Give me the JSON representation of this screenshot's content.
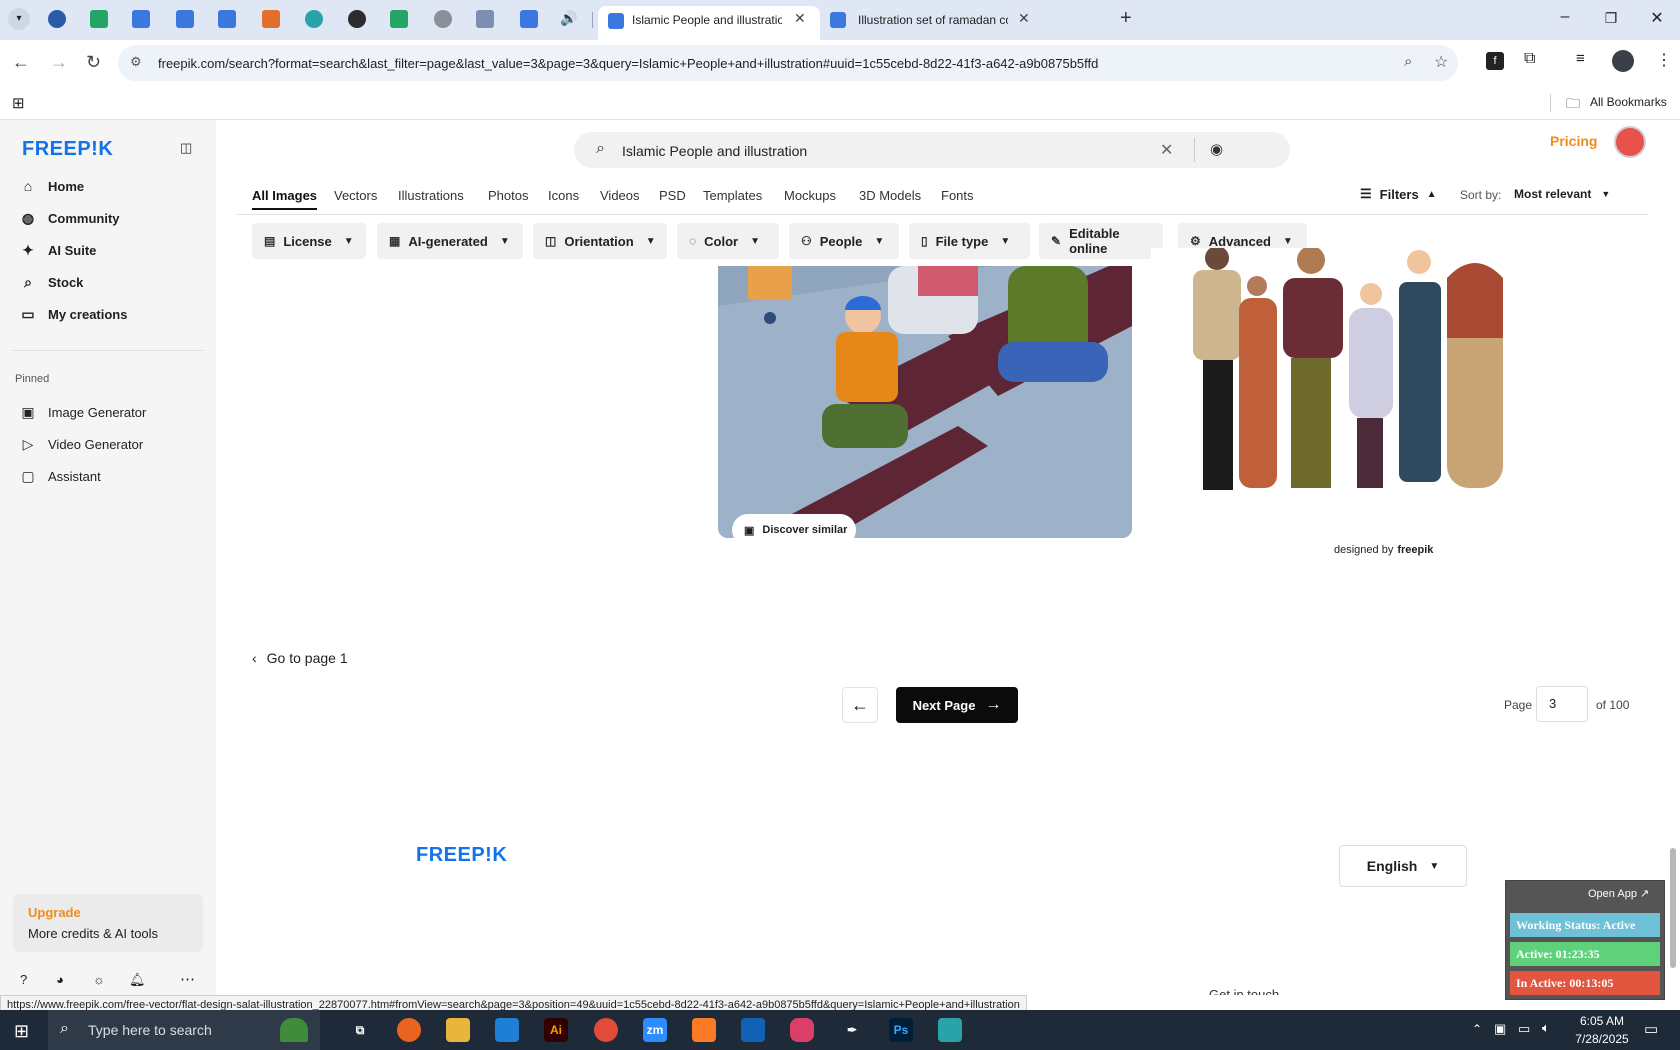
{
  "browser": {
    "tabs": [
      {
        "title": "Islamic People and illustration v",
        "active": true
      },
      {
        "title": "Illustration set of ramadan conc",
        "active": false
      }
    ],
    "url": "freepik.com/search?format=search&last_filter=page&last_value=3&page=3&query=Islamic+People+and+illustration#uuid=1c55cebd-8d22-41f3-a642-a9b0875b5ffd",
    "bookmarks_label": "All Bookmarks",
    "new_tab": "+",
    "status_url": "https://www.freepik.com/free-vector/flat-design-salat-illustration_22870077.htm#fromView=search&page=3&position=49&uuid=1c55cebd-8d22-41f3-a642-a9b0875b5ffd&query=Islamic+People+and+illustration"
  },
  "sidebar": {
    "logo": "FREEP!K",
    "items": [
      {
        "label": "Home",
        "icon": "home-icon"
      },
      {
        "label": "Community",
        "icon": "globe-icon"
      },
      {
        "label": "AI Suite",
        "icon": "sparkle-icon"
      },
      {
        "label": "Stock",
        "icon": "search-icon"
      },
      {
        "label": "My creations",
        "icon": "folder-icon"
      }
    ],
    "pinned_label": "Pinned",
    "pinned": [
      {
        "label": "Image Generator",
        "icon": "image-icon"
      },
      {
        "label": "Video Generator",
        "icon": "video-icon"
      },
      {
        "label": "Assistant",
        "icon": "chat-icon"
      }
    ],
    "upgrade_title": "Upgrade",
    "upgrade_sub": "More credits & AI tools"
  },
  "header": {
    "search_value": "Islamic People and illustration",
    "pricing": "Pricing"
  },
  "type_tabs": [
    "All Images",
    "Vectors",
    "Illustrations",
    "Photos",
    "Icons",
    "Videos",
    "PSD",
    "Templates",
    "Mockups",
    "3D Models",
    "Fonts"
  ],
  "filters_label": "Filters",
  "sort_label": "Sort by:",
  "sort_value": "Most relevant",
  "chips": [
    "License",
    "AI-generated",
    "Orientation",
    "Color",
    "People",
    "File type",
    "Editable online",
    "Advanced"
  ],
  "results": {
    "discover_similar": "Discover similar",
    "designed_by": "designed by",
    "designed_by_brand": "freepik"
  },
  "pager": {
    "go_to_page1": "Go to page 1",
    "next_page": "Next Page",
    "page_label": "Page",
    "page_value": "3",
    "of_total": "of 100"
  },
  "footer": {
    "logo": "FREEP!K",
    "language": "English",
    "get_in_touch": "Get in touch"
  },
  "widget": {
    "open_app": "Open App ↗",
    "working_status": "Working Status: Active",
    "active": "Active: 01:23:35",
    "inactive": "In Active: 00:13:05"
  },
  "taskbar": {
    "search_placeholder": "Type here to search",
    "time": "6:05 AM",
    "date": "7/28/2025"
  },
  "colors": {
    "brand": "#1273eb",
    "pricing": "#f28c1b",
    "widget_status": "#6ec1d6",
    "widget_active": "#5fd17a",
    "widget_inactive": "#e2563f"
  }
}
